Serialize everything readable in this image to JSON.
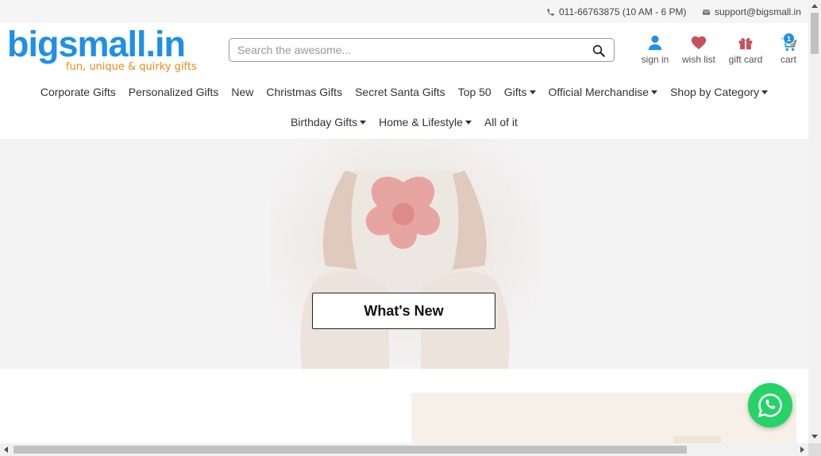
{
  "topbar": {
    "phone": "011-66763875 (10 AM - 6 PM)",
    "email": "support@bigsmall.in"
  },
  "logo": {
    "name": "bigsmall.in",
    "tagline": "fun, unique & quirky gifts"
  },
  "search": {
    "placeholder": "Search the awesome..."
  },
  "header_actions": {
    "signin": "sign in",
    "wishlist": "wish list",
    "giftcard": "gift card",
    "cart": "cart",
    "cart_count": "1"
  },
  "nav": {
    "row1": [
      {
        "label": "Corporate Gifts",
        "dropdown": false
      },
      {
        "label": "Personalized Gifts",
        "dropdown": false
      },
      {
        "label": "New",
        "dropdown": false
      },
      {
        "label": "Christmas Gifts",
        "dropdown": false
      },
      {
        "label": "Secret Santa Gifts",
        "dropdown": false
      },
      {
        "label": "Top 50",
        "dropdown": false
      },
      {
        "label": "Gifts",
        "dropdown": true
      },
      {
        "label": "Official Merchandise",
        "dropdown": true
      },
      {
        "label": "Shop by Category",
        "dropdown": true
      }
    ],
    "row2": [
      {
        "label": "Birthday Gifts",
        "dropdown": true
      },
      {
        "label": "Home & Lifestyle",
        "dropdown": true
      },
      {
        "label": "All of it",
        "dropdown": false
      }
    ]
  },
  "hero": {
    "cta_label": "What's New"
  },
  "colors": {
    "brand_blue": "#1f8fe8",
    "brand_orange": "#f08a1b",
    "wish_red": "#c8505a",
    "whatsapp_green": "#25d366"
  }
}
